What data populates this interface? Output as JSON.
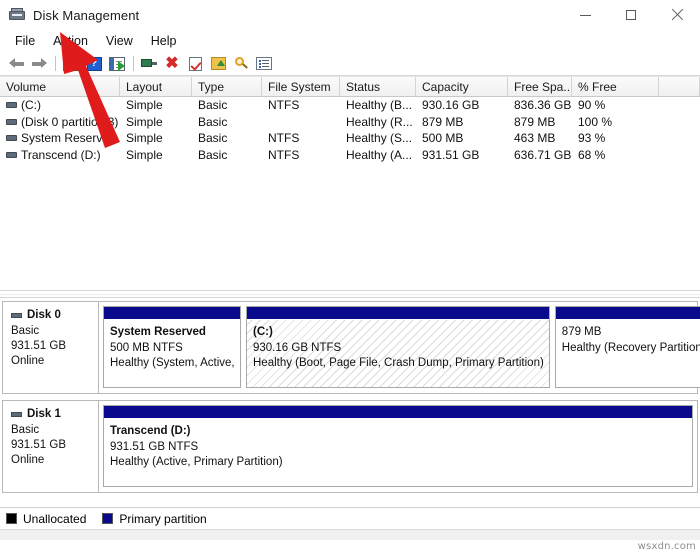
{
  "window": {
    "title": "Disk Management",
    "icon": "disk-drive-icon",
    "controls": {
      "minimize": "–",
      "maximize": "□",
      "close": "✕"
    }
  },
  "menubar": {
    "items": [
      {
        "label": "File",
        "name": "menu-file"
      },
      {
        "label": "Action",
        "name": "menu-action"
      },
      {
        "label": "View",
        "name": "menu-view"
      },
      {
        "label": "Help",
        "name": "menu-help"
      }
    ]
  },
  "toolbar": {
    "buttons": [
      {
        "name": "back-button",
        "icon": "arrow-left-icon"
      },
      {
        "name": "forward-button",
        "icon": "arrow-right-icon"
      },
      {
        "name": "show-hide-console-tree-button",
        "icon": "console-tree-icon"
      },
      {
        "name": "help-button",
        "icon": "question-mark-icon"
      },
      {
        "name": "show-hide-action-pane-button",
        "icon": "action-pane-icon"
      },
      {
        "name": "properties-button",
        "icon": "monitor-icon"
      },
      {
        "name": "delete-button",
        "icon": "red-x-icon"
      },
      {
        "name": "rescan-disks-button",
        "icon": "checkmark-icon"
      },
      {
        "name": "export-list-button",
        "icon": "folder-up-icon"
      },
      {
        "name": "search-button",
        "icon": "magnifier-icon"
      },
      {
        "name": "view-list-button",
        "icon": "list-view-icon"
      }
    ]
  },
  "volume_table": {
    "columns": [
      {
        "key": "volume",
        "label": "Volume"
      },
      {
        "key": "layout",
        "label": "Layout"
      },
      {
        "key": "type",
        "label": "Type"
      },
      {
        "key": "file_system",
        "label": "File System"
      },
      {
        "key": "status",
        "label": "Status"
      },
      {
        "key": "capacity",
        "label": "Capacity"
      },
      {
        "key": "free_space",
        "label": "Free Spa..."
      },
      {
        "key": "percent_free",
        "label": "% Free"
      }
    ],
    "rows": [
      {
        "volume": "(C:)",
        "layout": "Simple",
        "type": "Basic",
        "file_system": "NTFS",
        "status": "Healthy (B...",
        "capacity": "930.16 GB",
        "free_space": "836.36 GB",
        "percent_free": "90 %"
      },
      {
        "volume": "(Disk 0 partition 3)",
        "layout": "Simple",
        "type": "Basic",
        "file_system": "",
        "status": "Healthy (R...",
        "capacity": "879 MB",
        "free_space": "879 MB",
        "percent_free": "100 %"
      },
      {
        "volume": "System Reserved",
        "layout": "Simple",
        "type": "Basic",
        "file_system": "NTFS",
        "status": "Healthy (S...",
        "capacity": "500 MB",
        "free_space": "463 MB",
        "percent_free": "93 %"
      },
      {
        "volume": "Transcend (D:)",
        "layout": "Simple",
        "type": "Basic",
        "file_system": "NTFS",
        "status": "Healthy (A...",
        "capacity": "931.51 GB",
        "free_space": "636.71 GB",
        "percent_free": "68 %"
      }
    ]
  },
  "graphical_view": {
    "disks": [
      {
        "name": "Disk 0",
        "type": "Basic",
        "size": "931.51 GB",
        "state": "Online",
        "partitions": [
          {
            "name": "System Reserved",
            "size_fs": "500 MB NTFS",
            "status": "Healthy (System, Active,",
            "hatched": false,
            "bar_color": "#0a0a8c"
          },
          {
            "name": "(C:)",
            "size_fs": "930.16 GB NTFS",
            "status": "Healthy (Boot, Page File, Crash Dump, Primary Partition)",
            "hatched": true,
            "bar_color": "#0a0a8c"
          },
          {
            "name": "",
            "size_fs": "879 MB",
            "status": "Healthy (Recovery Partition",
            "hatched": false,
            "bar_color": "#0a0a8c"
          }
        ]
      },
      {
        "name": "Disk 1",
        "type": "Basic",
        "size": "931.51 GB",
        "state": "Online",
        "partitions": [
          {
            "name": "Transcend  (D:)",
            "size_fs": "931.51 GB NTFS",
            "status": "Healthy (Active, Primary Partition)",
            "hatched": false,
            "bar_color": "#0a0a8c"
          }
        ]
      }
    ]
  },
  "legend": {
    "items": [
      {
        "label": "Unallocated",
        "color": "#000000",
        "name": "legend-unallocated"
      },
      {
        "label": "Primary partition",
        "color": "#0a0a8c",
        "name": "legend-primary-partition"
      }
    ]
  },
  "annotation": {
    "type": "red-arrow",
    "points_to": "Action",
    "color": "#e01b1b"
  },
  "watermark": {
    "text": "wsxdn.com"
  }
}
